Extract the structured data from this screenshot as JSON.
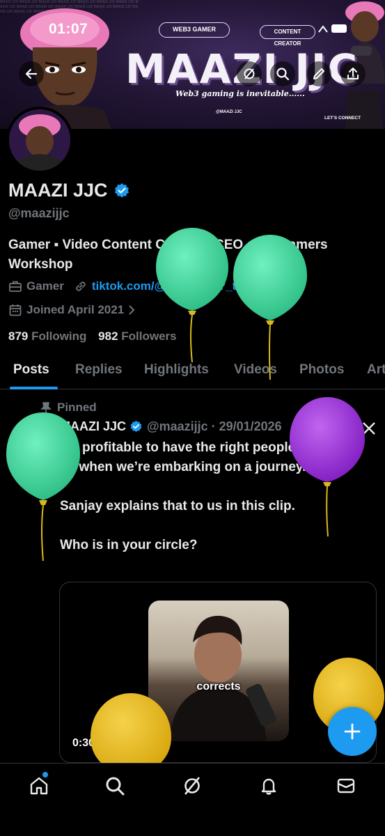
{
  "status_bar": {
    "time": "01:07"
  },
  "banner": {
    "title": "MAAZI JJC",
    "tagline": "Web3 gaming is inevitable......",
    "tag_left": "WEB3 GAMER",
    "tag_right": "CONTENT CREATOR",
    "handle": "@MAAZI JJC",
    "connect": "LET'S CONNECT",
    "pattern_text": "MAAZI JJC MAAZI JJC MAAZI JJC MAAZI JJC MAAZI JJC MAAZI JJC MAAZI JJC MAAZI JJC MAAZI JJC MAAZI JJC MAAZI JJC MAAZI JJC MAAZI JJC MAAZI JJC MAAZI JJC MAAZI JJC MAAZI JJC MAAZI JJC"
  },
  "header_icons": [
    "back-arrow-icon",
    "grok-icon",
    "search-icon",
    "edit-icon",
    "share-icon"
  ],
  "profile": {
    "display_name": "MAAZI JJC",
    "handle": "@maazijjc",
    "bio": "Gamer ▪ Video Content Creator • CEO of Streamers Workshop",
    "category": "Gamer",
    "link": "tiktok.com/@maazi_jjc?_t=...",
    "joined": "Joined April 2021",
    "following_count": "879",
    "following_label": "Following",
    "followers_count": "982",
    "followers_label": "Followers",
    "verified_color": "#1d9bf0"
  },
  "tabs": [
    {
      "label": "Posts"
    },
    {
      "label": "Replies"
    },
    {
      "label": "Highlights"
    },
    {
      "label": "Videos"
    },
    {
      "label": "Photos"
    },
    {
      "label": "Art"
    }
  ],
  "post": {
    "pinned_label": "Pinned",
    "author": "MAAZI JJC",
    "handle_date": "@maazijjc · 29/01/2026",
    "paragraphs": [
      "It’s profitable to have the right people around us when we’re embarking on a journey.",
      "Sanjay explains that to us in this clip.",
      "Who is in your circle?"
    ],
    "video_caption": "corrects",
    "video_duration": "0:30"
  },
  "fab": {
    "label": "+"
  },
  "bottom_nav": [
    "home-icon",
    "search-icon",
    "grok-icon",
    "notifications-icon",
    "messages-icon"
  ],
  "colors": {
    "accent": "#1d9bf0",
    "balloon_green": "#3ddc97",
    "balloon_purple": "#9b30d9",
    "balloon_gold": "#e8b820"
  }
}
